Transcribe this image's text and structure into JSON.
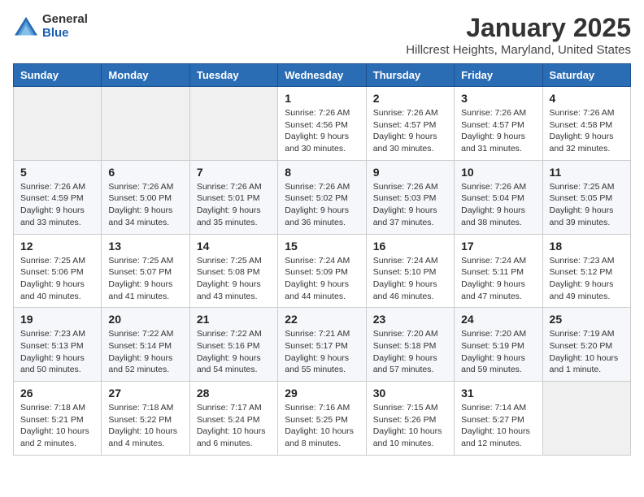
{
  "logo": {
    "general": "General",
    "blue": "Blue"
  },
  "title": {
    "month": "January 2025",
    "location": "Hillcrest Heights, Maryland, United States"
  },
  "days_of_week": [
    "Sunday",
    "Monday",
    "Tuesday",
    "Wednesday",
    "Thursday",
    "Friday",
    "Saturday"
  ],
  "weeks": [
    [
      {
        "day": "",
        "info": ""
      },
      {
        "day": "",
        "info": ""
      },
      {
        "day": "",
        "info": ""
      },
      {
        "day": "1",
        "info": "Sunrise: 7:26 AM\nSunset: 4:56 PM\nDaylight: 9 hours\nand 30 minutes."
      },
      {
        "day": "2",
        "info": "Sunrise: 7:26 AM\nSunset: 4:57 PM\nDaylight: 9 hours\nand 30 minutes."
      },
      {
        "day": "3",
        "info": "Sunrise: 7:26 AM\nSunset: 4:57 PM\nDaylight: 9 hours\nand 31 minutes."
      },
      {
        "day": "4",
        "info": "Sunrise: 7:26 AM\nSunset: 4:58 PM\nDaylight: 9 hours\nand 32 minutes."
      }
    ],
    [
      {
        "day": "5",
        "info": "Sunrise: 7:26 AM\nSunset: 4:59 PM\nDaylight: 9 hours\nand 33 minutes."
      },
      {
        "day": "6",
        "info": "Sunrise: 7:26 AM\nSunset: 5:00 PM\nDaylight: 9 hours\nand 34 minutes."
      },
      {
        "day": "7",
        "info": "Sunrise: 7:26 AM\nSunset: 5:01 PM\nDaylight: 9 hours\nand 35 minutes."
      },
      {
        "day": "8",
        "info": "Sunrise: 7:26 AM\nSunset: 5:02 PM\nDaylight: 9 hours\nand 36 minutes."
      },
      {
        "day": "9",
        "info": "Sunrise: 7:26 AM\nSunset: 5:03 PM\nDaylight: 9 hours\nand 37 minutes."
      },
      {
        "day": "10",
        "info": "Sunrise: 7:26 AM\nSunset: 5:04 PM\nDaylight: 9 hours\nand 38 minutes."
      },
      {
        "day": "11",
        "info": "Sunrise: 7:25 AM\nSunset: 5:05 PM\nDaylight: 9 hours\nand 39 minutes."
      }
    ],
    [
      {
        "day": "12",
        "info": "Sunrise: 7:25 AM\nSunset: 5:06 PM\nDaylight: 9 hours\nand 40 minutes."
      },
      {
        "day": "13",
        "info": "Sunrise: 7:25 AM\nSunset: 5:07 PM\nDaylight: 9 hours\nand 41 minutes."
      },
      {
        "day": "14",
        "info": "Sunrise: 7:25 AM\nSunset: 5:08 PM\nDaylight: 9 hours\nand 43 minutes."
      },
      {
        "day": "15",
        "info": "Sunrise: 7:24 AM\nSunset: 5:09 PM\nDaylight: 9 hours\nand 44 minutes."
      },
      {
        "day": "16",
        "info": "Sunrise: 7:24 AM\nSunset: 5:10 PM\nDaylight: 9 hours\nand 46 minutes."
      },
      {
        "day": "17",
        "info": "Sunrise: 7:24 AM\nSunset: 5:11 PM\nDaylight: 9 hours\nand 47 minutes."
      },
      {
        "day": "18",
        "info": "Sunrise: 7:23 AM\nSunset: 5:12 PM\nDaylight: 9 hours\nand 49 minutes."
      }
    ],
    [
      {
        "day": "19",
        "info": "Sunrise: 7:23 AM\nSunset: 5:13 PM\nDaylight: 9 hours\nand 50 minutes."
      },
      {
        "day": "20",
        "info": "Sunrise: 7:22 AM\nSunset: 5:14 PM\nDaylight: 9 hours\nand 52 minutes."
      },
      {
        "day": "21",
        "info": "Sunrise: 7:22 AM\nSunset: 5:16 PM\nDaylight: 9 hours\nand 54 minutes."
      },
      {
        "day": "22",
        "info": "Sunrise: 7:21 AM\nSunset: 5:17 PM\nDaylight: 9 hours\nand 55 minutes."
      },
      {
        "day": "23",
        "info": "Sunrise: 7:20 AM\nSunset: 5:18 PM\nDaylight: 9 hours\nand 57 minutes."
      },
      {
        "day": "24",
        "info": "Sunrise: 7:20 AM\nSunset: 5:19 PM\nDaylight: 9 hours\nand 59 minutes."
      },
      {
        "day": "25",
        "info": "Sunrise: 7:19 AM\nSunset: 5:20 PM\nDaylight: 10 hours\nand 1 minute."
      }
    ],
    [
      {
        "day": "26",
        "info": "Sunrise: 7:18 AM\nSunset: 5:21 PM\nDaylight: 10 hours\nand 2 minutes."
      },
      {
        "day": "27",
        "info": "Sunrise: 7:18 AM\nSunset: 5:22 PM\nDaylight: 10 hours\nand 4 minutes."
      },
      {
        "day": "28",
        "info": "Sunrise: 7:17 AM\nSunset: 5:24 PM\nDaylight: 10 hours\nand 6 minutes."
      },
      {
        "day": "29",
        "info": "Sunrise: 7:16 AM\nSunset: 5:25 PM\nDaylight: 10 hours\nand 8 minutes."
      },
      {
        "day": "30",
        "info": "Sunrise: 7:15 AM\nSunset: 5:26 PM\nDaylight: 10 hours\nand 10 minutes."
      },
      {
        "day": "31",
        "info": "Sunrise: 7:14 AM\nSunset: 5:27 PM\nDaylight: 10 hours\nand 12 minutes."
      },
      {
        "day": "",
        "info": ""
      }
    ]
  ]
}
